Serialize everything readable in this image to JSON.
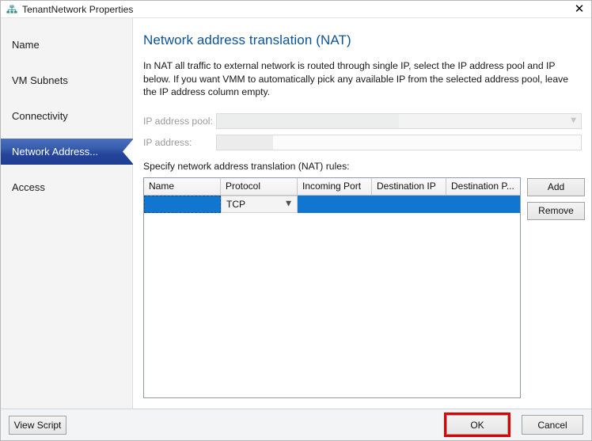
{
  "window": {
    "title": "TenantNetwork Properties",
    "icon": "network-icon",
    "close_icon": "close-icon"
  },
  "sidebar": {
    "items": [
      {
        "label": "Name",
        "selected": false
      },
      {
        "label": "VM Subnets",
        "selected": false
      },
      {
        "label": "Connectivity",
        "selected": false
      },
      {
        "label": "Network Address...",
        "selected": true
      },
      {
        "label": "Access",
        "selected": false
      }
    ]
  },
  "main": {
    "title": "Network address translation (NAT)",
    "description": "In NAT all traffic to external network is routed through single IP, select the IP address pool and IP below. If you want VMM to automatically pick any available IP from the selected address pool, leave the IP address column empty.",
    "fields": [
      {
        "label": "IP address pool:",
        "value": "",
        "type": "combo",
        "disabled": true
      },
      {
        "label": "IP address:",
        "value": "",
        "type": "text",
        "disabled": true
      }
    ],
    "rules_label": "Specify network address translation (NAT) rules:",
    "grid": {
      "columns": [
        "Name",
        "Protocol",
        "Incoming Port",
        "Destination IP",
        "Destination P..."
      ],
      "rows": [
        {
          "name": "",
          "protocol": "TCP",
          "incoming_port": "",
          "destination_ip": "",
          "destination_port": "",
          "selected": true
        }
      ]
    },
    "side_buttons": [
      {
        "label": "Add"
      },
      {
        "label": "Remove"
      }
    ]
  },
  "footer": {
    "view_script_label": "View Script",
    "ok_label": "OK",
    "cancel_label": "Cancel",
    "highlight_color": "#e00000"
  }
}
